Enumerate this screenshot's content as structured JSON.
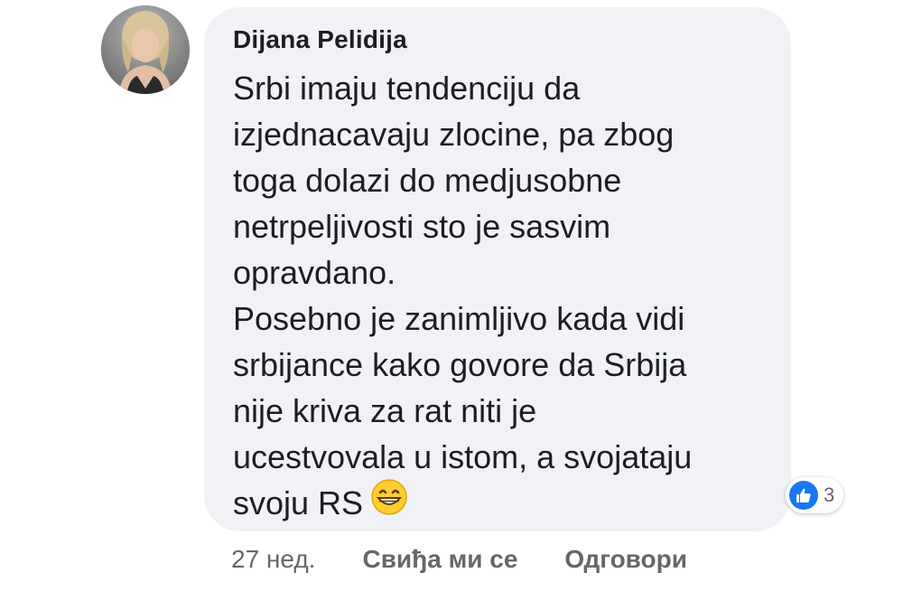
{
  "comment": {
    "author": "Dijana Pelidija",
    "text_lines": [
      "Srbi imaju tendenciju da",
      "izjednacavaju zlocine, pa zbog",
      "toga dolazi do medjusobne",
      "netrpeljivosti sto je sasvim",
      "opravdano.",
      "Posebno je zanimljivo kada vidi",
      "srbijance kako govore da Srbija",
      "nije kriva za rat niti je",
      "ucestvovala u istom, a svojataju",
      "svoju RS"
    ],
    "emoji": "grinning-face-emoji",
    "reactions": {
      "icon": "like-icon",
      "count": "3",
      "color": "#1877f2"
    }
  },
  "actions": {
    "time": "27 нед.",
    "like_label": "Свиђа ми се",
    "reply_label": "Одговори"
  },
  "colors": {
    "bubble": "#f0f2f5",
    "text": "#1c1e21",
    "secondary": "#65676b"
  }
}
